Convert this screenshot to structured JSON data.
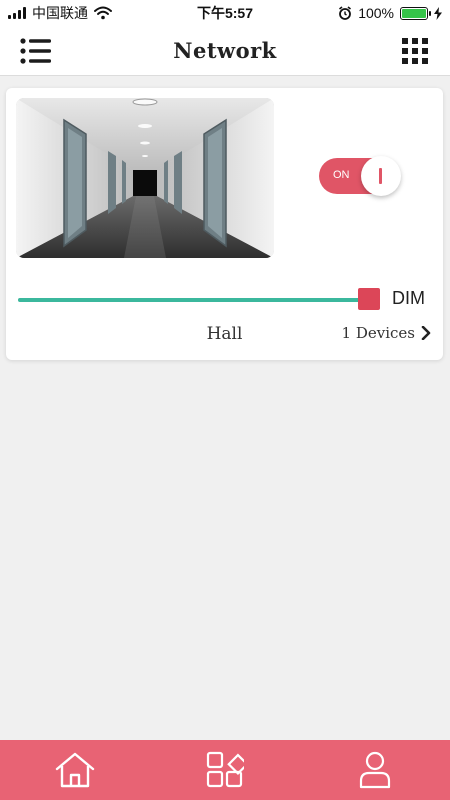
{
  "status_bar": {
    "carrier": "中国联通",
    "time": "下午5:57",
    "battery_percent": "100%",
    "battery_level": 1.0
  },
  "header": {
    "title": "Network",
    "menu_icon": "list-menu-icon",
    "apps_icon": "grid-apps-icon"
  },
  "room_card": {
    "toggle_label": "ON",
    "toggle_state": true,
    "dim_label": "DIM",
    "dim_level": 0.97,
    "room_name": "Hall",
    "devices_text": "1 Devices",
    "chevron_icon": "chevron-right-icon"
  },
  "tabbar": {
    "tabs": [
      {
        "icon": "home-icon"
      },
      {
        "icon": "scenes-grid-icon"
      },
      {
        "icon": "user-profile-icon"
      }
    ]
  },
  "colors": {
    "accent": "#e05566",
    "slider": "#3bb89d",
    "tabbar": "#e86374"
  }
}
